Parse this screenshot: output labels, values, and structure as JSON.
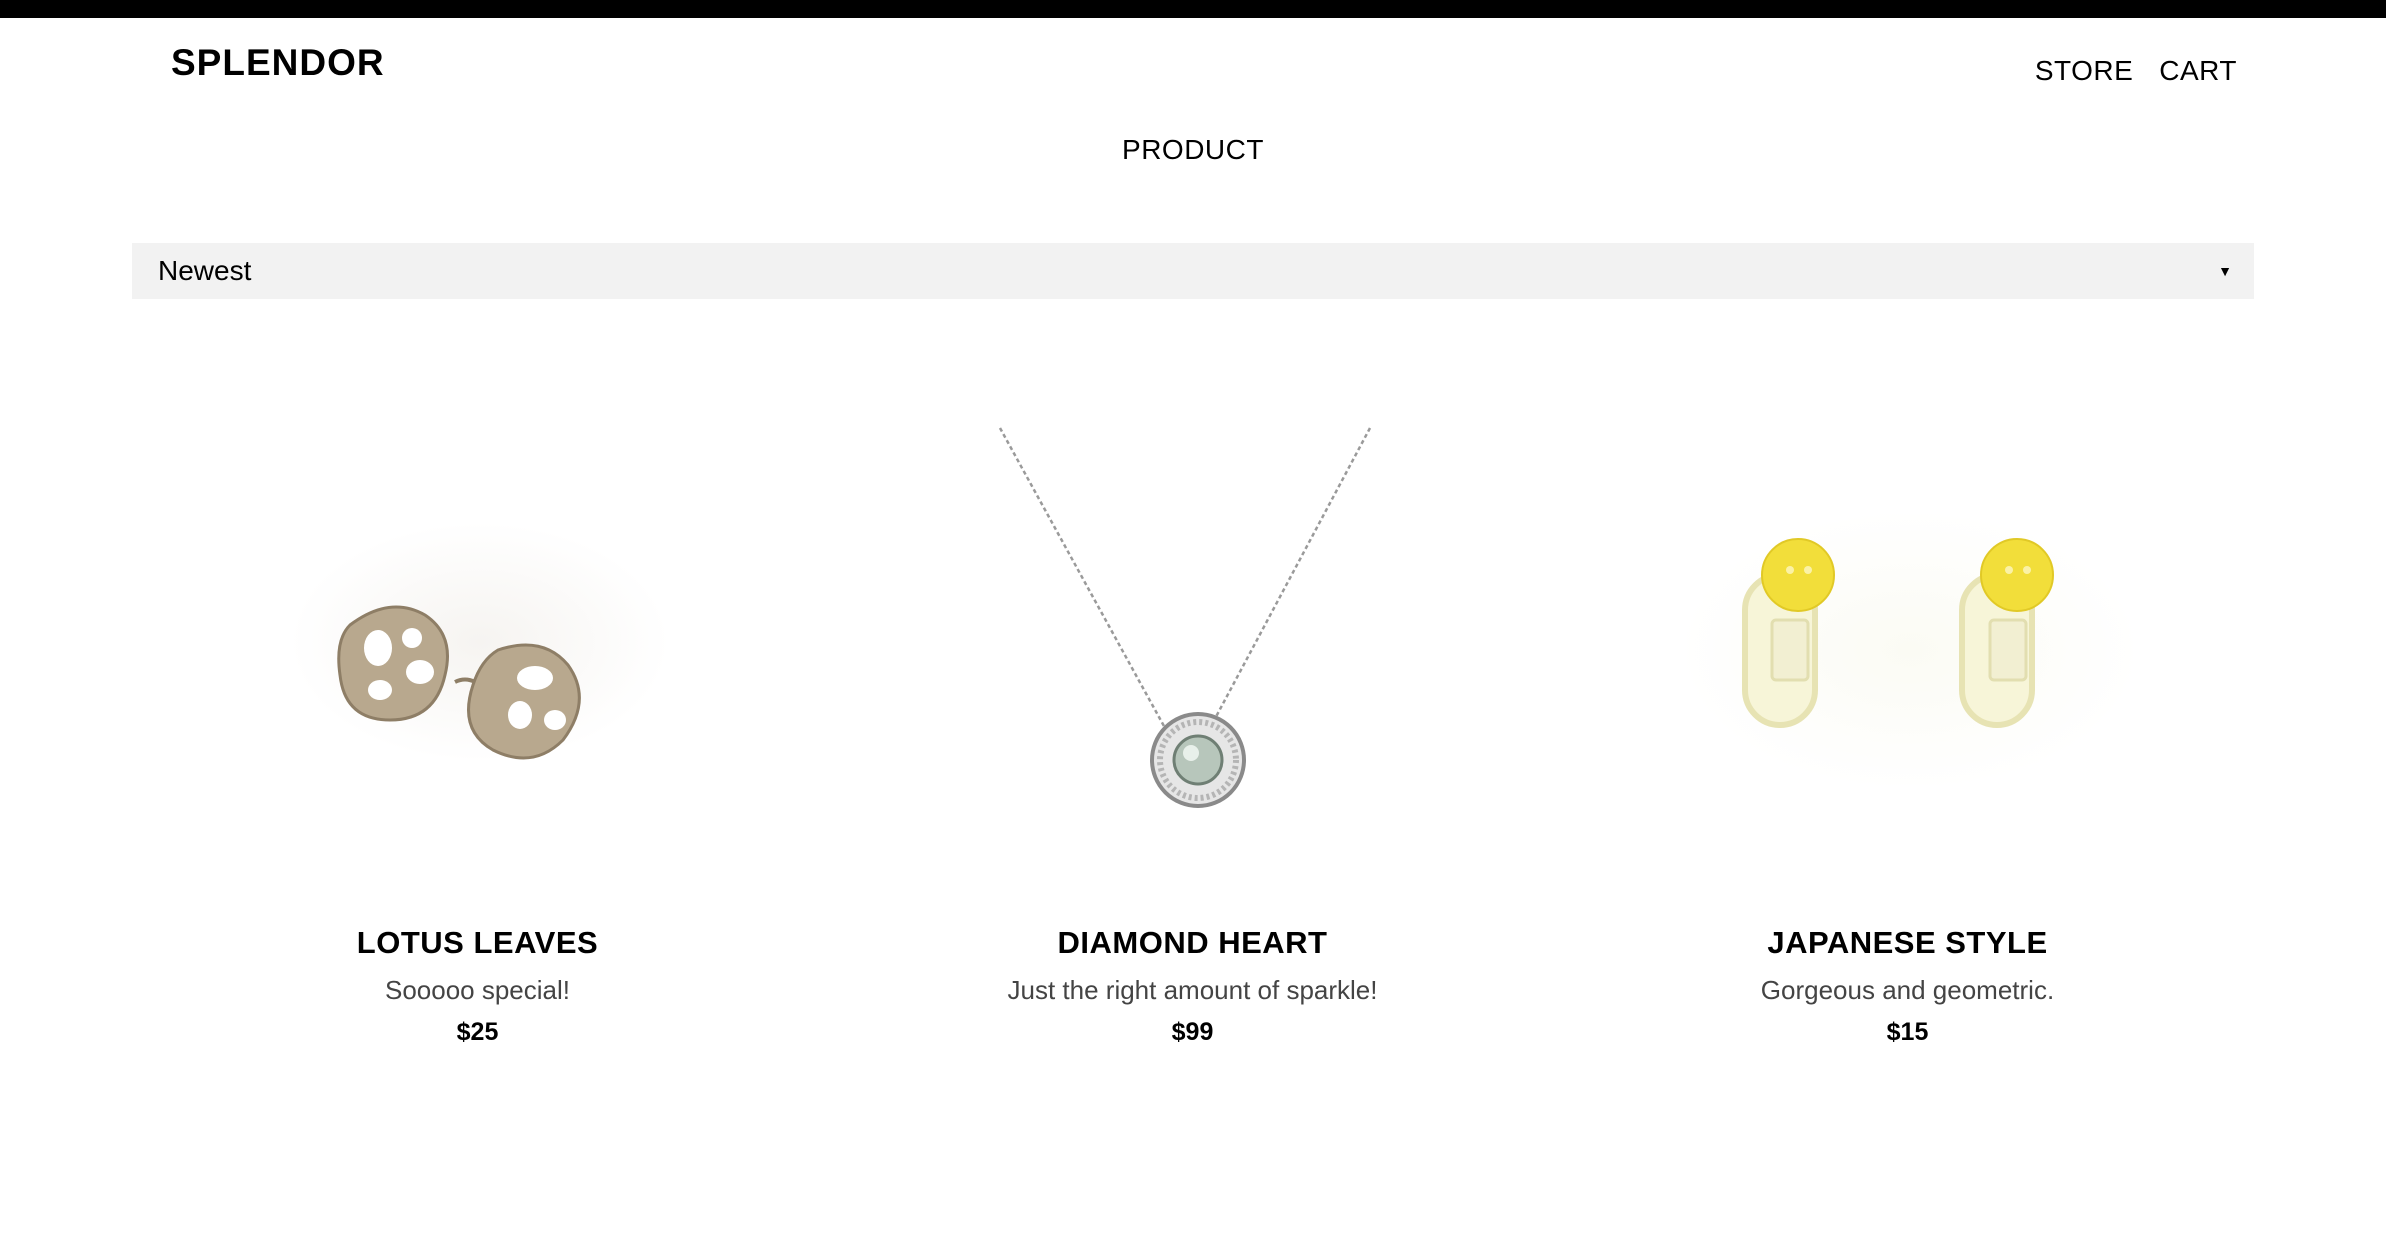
{
  "header": {
    "logo": "SPLENDOR",
    "nav": [
      "STORE",
      "CART"
    ]
  },
  "page": {
    "title": "PRODUCT"
  },
  "sort": {
    "selected": "Newest"
  },
  "products": [
    {
      "name": "LOTUS LEAVES",
      "description": "Sooooo special!",
      "price": "$25",
      "image_icon": "lotus-ring-icon"
    },
    {
      "name": "DIAMOND HEART",
      "description": "Just the right amount of sparkle!",
      "price": "$99",
      "image_icon": "diamond-necklace-icon"
    },
    {
      "name": "JAPANESE STYLE",
      "description": "Gorgeous and geometric.",
      "price": "$15",
      "image_icon": "yellow-earrings-icon"
    }
  ]
}
